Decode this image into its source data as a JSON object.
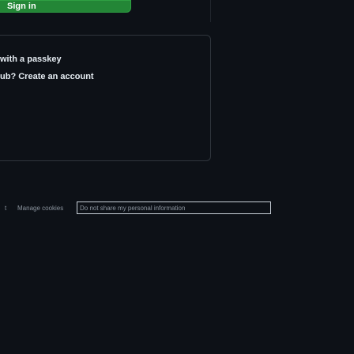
{
  "signin": {
    "label": "Sign in"
  },
  "passkey": {
    "label": "with a passkey"
  },
  "new_account": {
    "prefix": "ub?",
    "link": "Create an account"
  },
  "footer": {
    "truncated_item": "t",
    "manage_cookies": "Manage cookies",
    "do_not_share": "Do not share my personal information"
  },
  "colors": {
    "background": "#0d1117",
    "button_green": "#238636",
    "border": "#30363d",
    "text": "#e6edf3",
    "muted": "#8b949e"
  }
}
